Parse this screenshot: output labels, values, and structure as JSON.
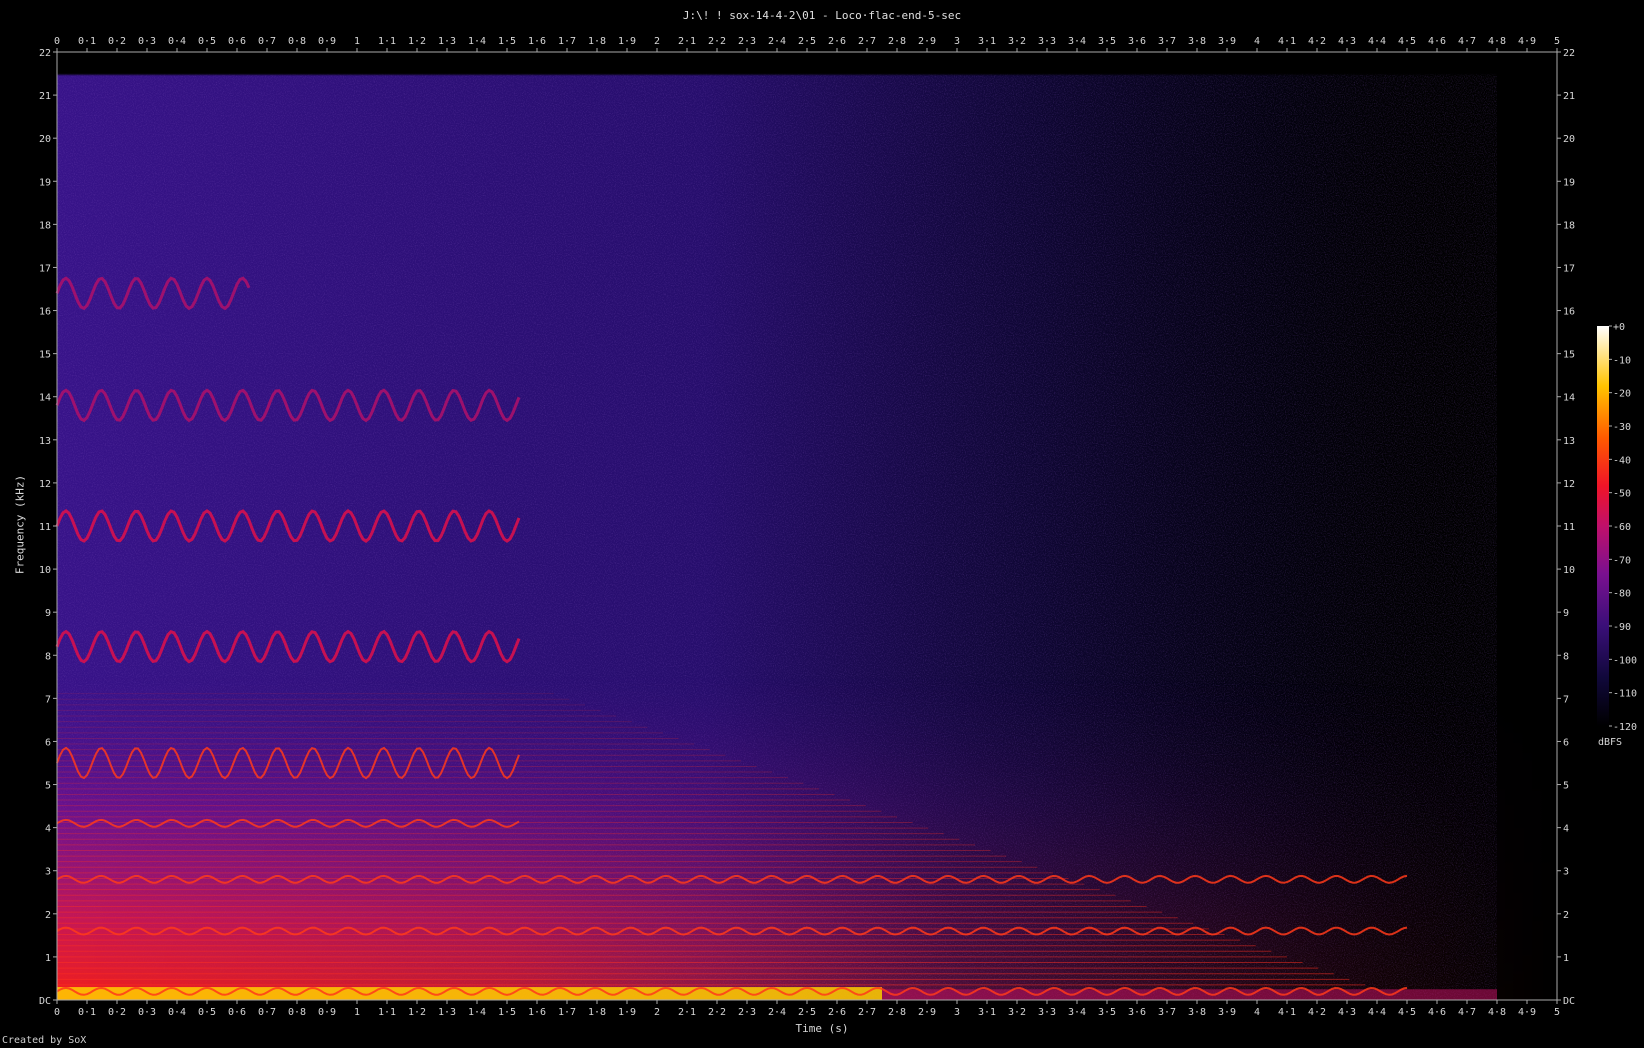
{
  "title": "J:\\! ! sox-14-4-2\\01 - Loco·flac-end-5-sec",
  "credit": "Created by SoX",
  "chart_data": {
    "type": "heatmap",
    "title": "J:\\! ! sox-14-4-2\\01 - Loco·flac-end-5-sec",
    "xlabel": "Time (s)",
    "ylabel": "Frequency (kHz)",
    "xlim": [
      0,
      5
    ],
    "ylim": [
      0,
      22
    ],
    "x_ticks": [
      "0",
      "0·1",
      "0·2",
      "0·3",
      "0·4",
      "0·5",
      "0·6",
      "0·7",
      "0·8",
      "0·9",
      "1",
      "1·1",
      "1·2",
      "1·3",
      "1·4",
      "1·5",
      "1·6",
      "1·7",
      "1·8",
      "1·9",
      "2",
      "2·1",
      "2·2",
      "2·3",
      "2·4",
      "2·5",
      "2·6",
      "2·7",
      "2·8",
      "2·9",
      "3",
      "3·1",
      "3·2",
      "3·3",
      "3·4",
      "3·5",
      "3·6",
      "3·7",
      "3·8",
      "3·9",
      "4",
      "4·1",
      "4·2",
      "4·3",
      "4·4",
      "4·5",
      "4·6",
      "4·7",
      "4·8",
      "4·9",
      "5"
    ],
    "y_ticks": [
      "DC",
      "1",
      "2",
      "3",
      "4",
      "5",
      "6",
      "7",
      "8",
      "9",
      "10",
      "11",
      "12",
      "13",
      "14",
      "15",
      "16",
      "17",
      "18",
      "19",
      "20",
      "21",
      "22"
    ],
    "colorbar": {
      "label": "dBFS",
      "range": [
        -120,
        0
      ],
      "ticks": [
        "+0",
        "-10",
        "-20",
        "-30",
        "-40",
        "-50",
        "-60",
        "-70",
        "-80",
        "-90",
        "-100",
        "-110",
        "-120"
      ]
    },
    "tonal_components_khz": [
      0.2,
      1.6,
      2.8,
      4.1,
      5.5,
      8.2,
      11.0,
      13.8,
      16.4
    ],
    "signal_end_time_s": 4.8,
    "colors": [
      "#000000",
      "#1a0a50",
      "#4a1080",
      "#8a1090",
      "#cc1050",
      "#ff1a10",
      "#ff7a00",
      "#ffd000",
      "#ffffd0"
    ]
  }
}
